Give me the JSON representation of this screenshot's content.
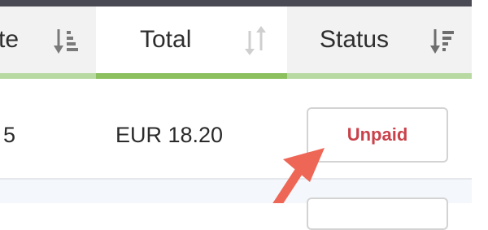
{
  "table": {
    "headers": [
      {
        "label": "te",
        "sort_icon": "sort-descending-icon"
      },
      {
        "label": "Total",
        "sort_icon": "sort-neutral-icon"
      },
      {
        "label": "Status",
        "sort_icon": "sort-filter-icon"
      }
    ],
    "rows": [
      {
        "date_fragment": "5",
        "total": "EUR 18.20",
        "status": "Unpaid"
      }
    ]
  },
  "annotation": {
    "arrow_color": "#ee6655",
    "icon": "callout-arrow-icon"
  },
  "colors": {
    "header_bg": "#f2f2f2",
    "active_underline": "#8cc05f",
    "underline": "#b9d9a3",
    "status_unpaid": "#c9424b"
  }
}
